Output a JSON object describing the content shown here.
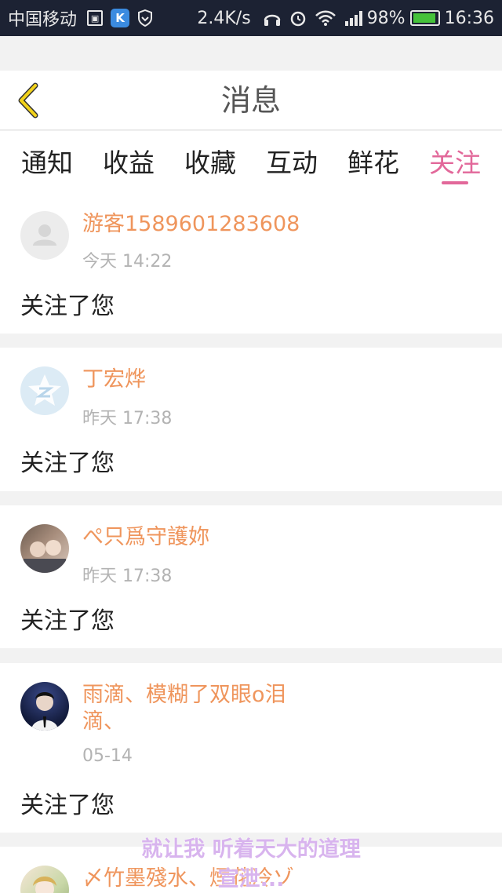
{
  "status_bar": {
    "carrier": "中国移动",
    "speed": "2.4K/s",
    "network_type": "G",
    "battery": "98%",
    "time": "16:36"
  },
  "header": {
    "title": "消息"
  },
  "tabs": [
    {
      "label": "通知"
    },
    {
      "label": "收益"
    },
    {
      "label": "收藏"
    },
    {
      "label": "互动"
    },
    {
      "label": "鲜花"
    },
    {
      "label": "关注"
    }
  ],
  "active_tab": "关注",
  "messages": [
    {
      "name": "游客1589601283608",
      "time": "今天 14:22",
      "text": "关注了您"
    },
    {
      "name": "丁宏烨",
      "time": "昨天 17:38",
      "text": "关注了您"
    },
    {
      "name": "ぺ只爲守護妳",
      "time": "昨天 17:38",
      "text": "关注了您"
    },
    {
      "name": "雨滴、模糊了双眼o泪滴、",
      "time": "05-14",
      "text": "关注了您"
    },
    {
      "name": "〆竹墨殘水、煙花冷ゾ",
      "time": "",
      "text": ""
    }
  ],
  "overlay_text": {
    "line1": "就让我 听着天大的道理",
    "line2": "宣泄..."
  },
  "colors": {
    "accent": "#e2689a",
    "name": "#ef955c",
    "back_icon": "#f2d21b"
  }
}
